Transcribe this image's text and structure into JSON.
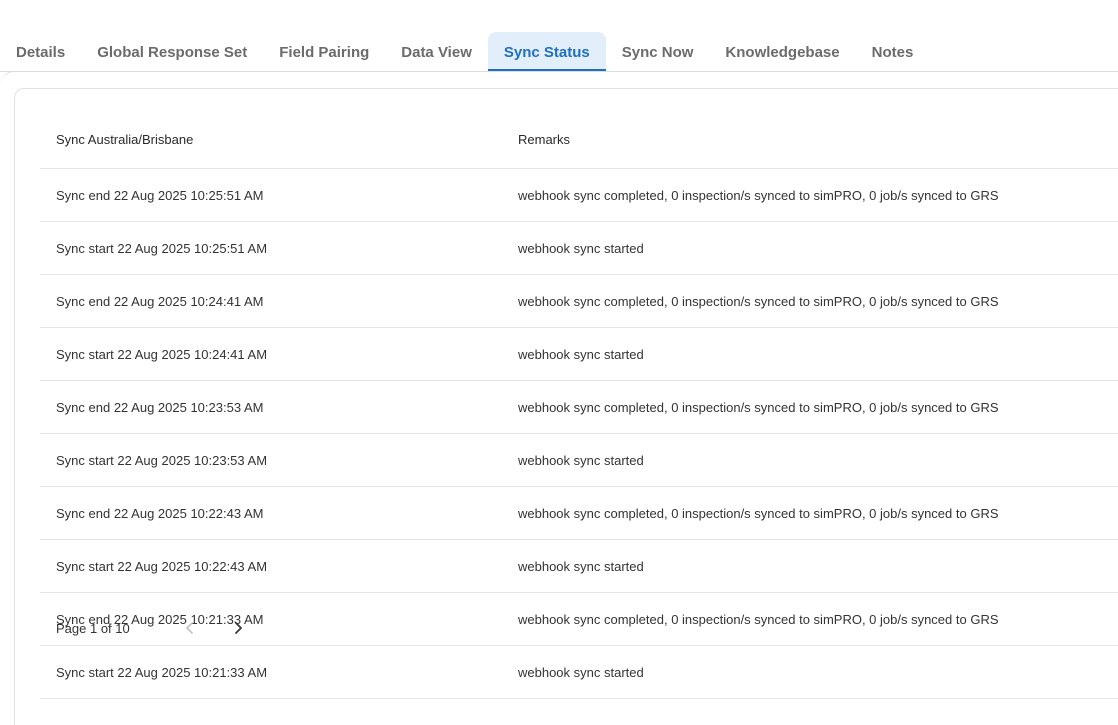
{
  "tabs": [
    {
      "label": "Details",
      "active": false
    },
    {
      "label": "Global Response Set",
      "active": false
    },
    {
      "label": "Field Pairing",
      "active": false
    },
    {
      "label": "Data View",
      "active": false
    },
    {
      "label": "Sync Status",
      "active": true
    },
    {
      "label": "Sync Now",
      "active": false
    },
    {
      "label": "Knowledgebase",
      "active": false
    },
    {
      "label": "Notes",
      "active": false
    }
  ],
  "accent_color": "#1f6fc2",
  "table": {
    "columns": [
      "Sync Australia/Brisbane",
      "Remarks"
    ],
    "rows": [
      {
        "time": "Sync end 22 Aug 2025 10:25:51 AM",
        "remarks": "webhook sync completed, 0 inspection/s synced to simPRO, 0 job/s synced to GRS"
      },
      {
        "time": "Sync start 22 Aug 2025 10:25:51 AM",
        "remarks": "webhook sync started"
      },
      {
        "time": "Sync end 22 Aug 2025 10:24:41 AM",
        "remarks": "webhook sync completed, 0 inspection/s synced to simPRO, 0 job/s synced to GRS"
      },
      {
        "time": "Sync start 22 Aug 2025 10:24:41 AM",
        "remarks": "webhook sync started"
      },
      {
        "time": "Sync end 22 Aug 2025 10:23:53 AM",
        "remarks": "webhook sync completed, 0 inspection/s synced to simPRO, 0 job/s synced to GRS"
      },
      {
        "time": "Sync start 22 Aug 2025 10:23:53 AM",
        "remarks": "webhook sync started"
      },
      {
        "time": "Sync end 22 Aug 2025 10:22:43 AM",
        "remarks": "webhook sync completed, 0 inspection/s synced to simPRO, 0 job/s synced to GRS"
      },
      {
        "time": "Sync start 22 Aug 2025 10:22:43 AM",
        "remarks": "webhook sync started"
      },
      {
        "time": "Sync end 22 Aug 2025 10:21:33 AM",
        "remarks": "webhook sync completed, 0 inspection/s synced to simPRO, 0 job/s synced to GRS"
      },
      {
        "time": "Sync start 22 Aug 2025 10:21:33 AM",
        "remarks": "webhook sync started"
      }
    ]
  },
  "pagination": {
    "label": "Page 1 of 10",
    "prev_icon": "chevron-left-icon",
    "next_icon": "chevron-right-icon"
  }
}
